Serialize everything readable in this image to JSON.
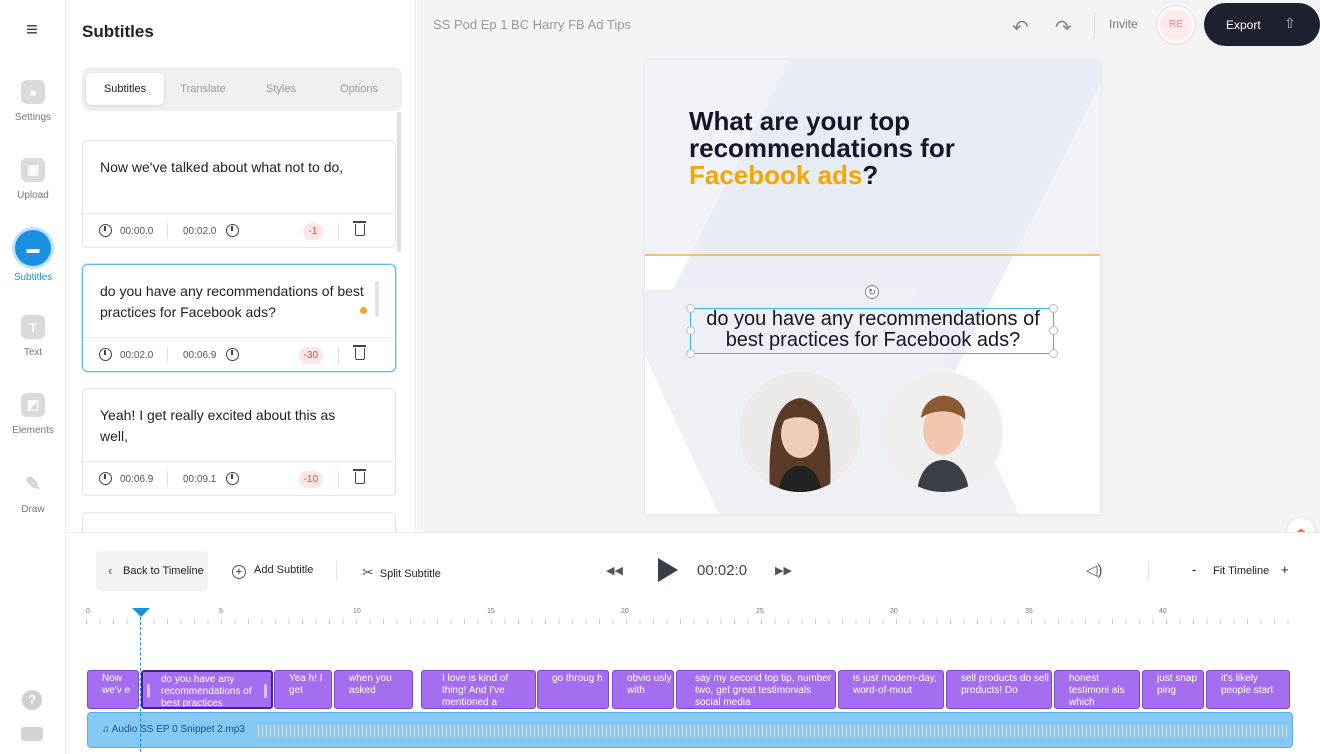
{
  "rail": {
    "items": [
      {
        "label": "Settings",
        "icon": "settings-icon"
      },
      {
        "label": "Upload",
        "icon": "upload-icon"
      },
      {
        "label": "Subtitles",
        "icon": "subtitles-icon"
      },
      {
        "label": "Text",
        "icon": "text-icon"
      },
      {
        "label": "Elements",
        "icon": "elements-icon"
      },
      {
        "label": "Draw",
        "icon": "draw-icon"
      }
    ],
    "text_icon_glyph": "T",
    "help_glyph": "?"
  },
  "panel": {
    "title": "Subtitles",
    "tabs": [
      "Subtitles",
      "Translate",
      "Styles",
      "Options"
    ],
    "cards": [
      {
        "text": "Now we've talked about what not to do,",
        "start": "00:00.0",
        "end": "00:02.0",
        "badge": "-1"
      },
      {
        "text": "do you have any recommendations of best practices for Facebook ads?",
        "start": "00:02.0",
        "end": "00:06.9",
        "badge": "-30"
      },
      {
        "text": "Yeah! I get really excited about this as well,",
        "start": "00:06.9",
        "end": "00:09.1",
        "badge": "-10"
      }
    ]
  },
  "header": {
    "doc_title": "SS Pod Ep 1 BC Harry FB Ad Tips",
    "invite": "Invite",
    "avatar_initials": "RE",
    "export": "Export"
  },
  "canvas": {
    "headline_line1": "What are your top",
    "headline_line2": "recommendations for",
    "headline_accent": "Facebook ads",
    "headline_end": "?",
    "caption": "do you have any recommendations of best practices for Facebook ads?"
  },
  "toolbar": {
    "back": "Back to Timeline",
    "add": "Add Subtitle",
    "split": "Split Subtitle",
    "time": "00:02:0",
    "fit": "Fit Timeline",
    "minus": "-",
    "plus": "+"
  },
  "timeline": {
    "ruler": [
      "0",
      "5",
      "10",
      "15",
      "20",
      "25",
      "30",
      "35",
      "40"
    ],
    "segments": [
      "Now we'v e",
      "do you have any recommendations of best practices",
      "Yea h! I get",
      "when you asked",
      "I love is kind of thing! And I've mentioned a",
      "go throug h",
      "obvio usly with",
      "say my second top tip, number two, get great testimonials social media",
      "is just modern-day, word-of-mout",
      "sell products do sell products! Do",
      "honest testimoni als which",
      "just snap ping",
      "it's likely people start"
    ],
    "audio": "Audio SS EP 0 Snippet 2.mp3"
  },
  "colors": {
    "accent": "#1b8fe0",
    "segment": "#a56ef0",
    "audio": "#86c9f5",
    "headline_accent": "#f5a600",
    "export_bg": "#1e2130"
  }
}
